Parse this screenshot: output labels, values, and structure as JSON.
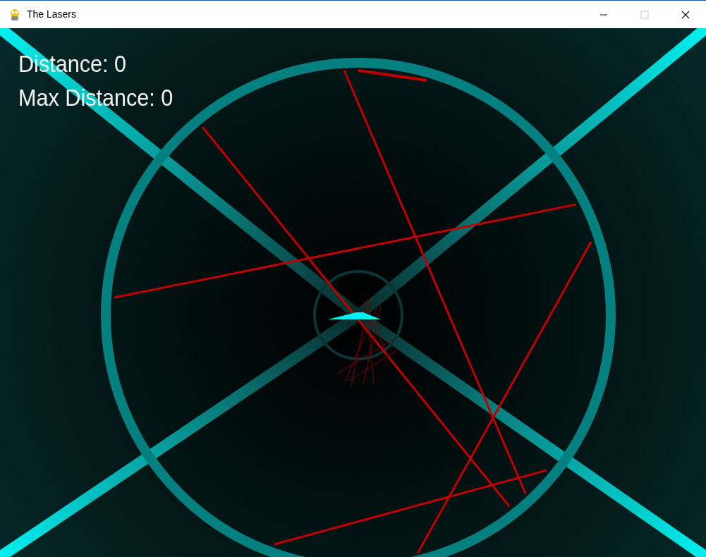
{
  "window": {
    "title": "The Lasers",
    "controls": [
      {
        "kind": "minimize",
        "disabled": false
      },
      {
        "kind": "maximize",
        "disabled": true
      },
      {
        "kind": "close",
        "disabled": false
      }
    ]
  },
  "hud": [
    "Distance: 0",
    "Max Distance: 0"
  ]
}
